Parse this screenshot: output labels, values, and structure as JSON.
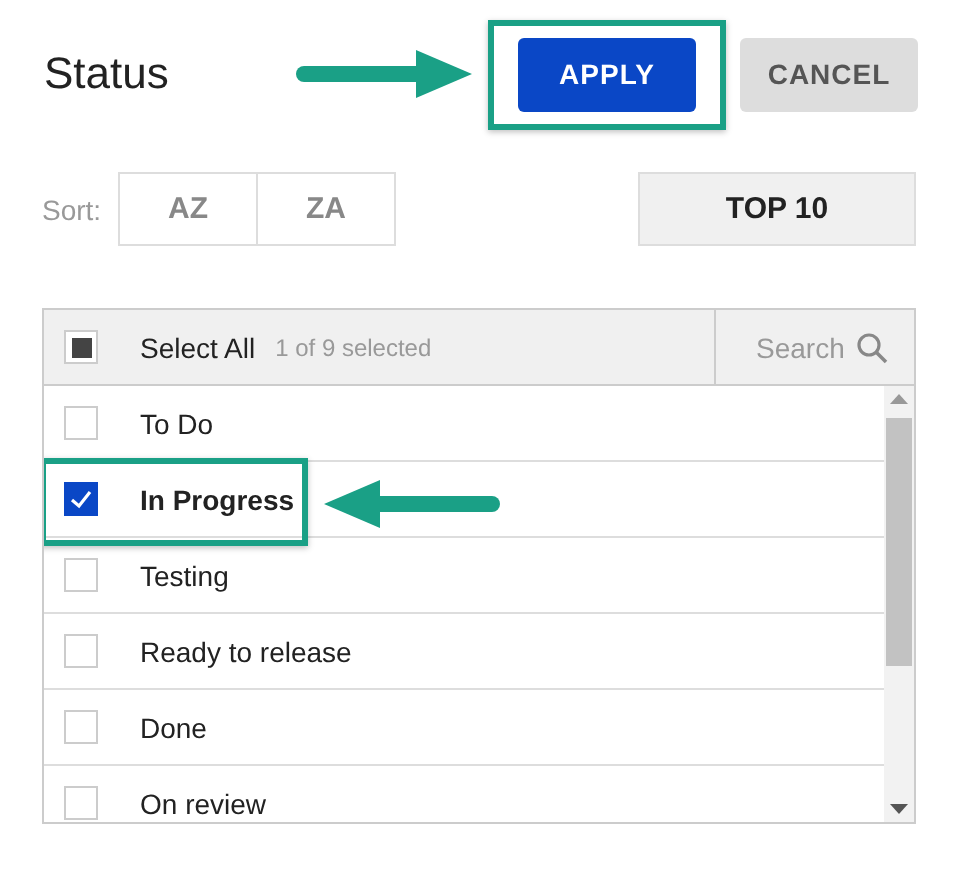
{
  "title": "Status",
  "actions": [
    {
      "label": "APPLY",
      "kind": "primary",
      "callout": true
    },
    {
      "label": "CANCEL",
      "kind": "secondary",
      "callout": false
    }
  ],
  "sort": {
    "label": "Sort:",
    "options": [
      {
        "label": "AZ"
      },
      {
        "label": "ZA"
      }
    ],
    "top": {
      "label": "TOP 10"
    }
  },
  "select_all": {
    "label": "Select All",
    "indeterminate": true,
    "count": "1 of 9 selected"
  },
  "search": {
    "placeholder": "Search"
  },
  "items": [
    {
      "label": "To Do",
      "checked": false,
      "callout": false
    },
    {
      "label": "In Progress",
      "checked": true,
      "callout": true
    },
    {
      "label": "Testing",
      "checked": false,
      "callout": false
    },
    {
      "label": "Ready to release",
      "checked": false,
      "callout": false
    },
    {
      "label": "Done",
      "checked": false,
      "callout": false
    },
    {
      "label": "On review",
      "checked": false,
      "callout": false
    }
  ]
}
